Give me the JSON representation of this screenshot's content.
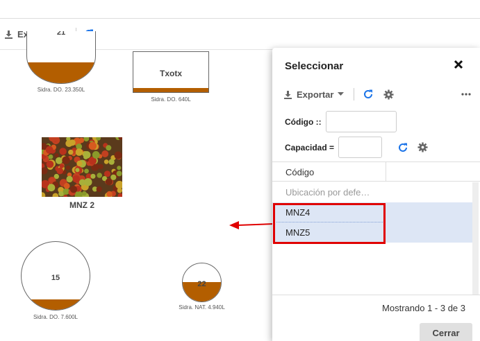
{
  "toolbar": {
    "export_label": "Exportar"
  },
  "canvas": {
    "tanks": [
      {
        "number": "21",
        "caption": "Sidra. DO. 23.350L",
        "fill_fraction": 0.43
      },
      {
        "number": "15",
        "caption": "Sidra. DO. 7.600L",
        "fill_fraction": 0.14
      },
      {
        "number": "22",
        "caption": "Sidra. NAT. 4.940L",
        "fill_fraction": 0.48
      }
    ],
    "rect_tank": {
      "name": "Txotx",
      "caption": "Sidra. DO. 640L"
    },
    "image_label": "MNZ 2"
  },
  "panel": {
    "title": "Seleccionar",
    "export_label": "Exportar",
    "codigo_label": "Código ::",
    "capacidad_label": "Capacidad =",
    "column_header": "Código",
    "rows": [
      "Ubicación por defe…",
      "MNZ4",
      "MNZ5"
    ],
    "footer": "Mostrando 1 - 3 de 3",
    "close_label": "Cerrar"
  },
  "colors": {
    "accent": "#1a73e8",
    "fill": "#b35e00",
    "highlight": "#e00000",
    "selected_row": "#dde6f5"
  }
}
